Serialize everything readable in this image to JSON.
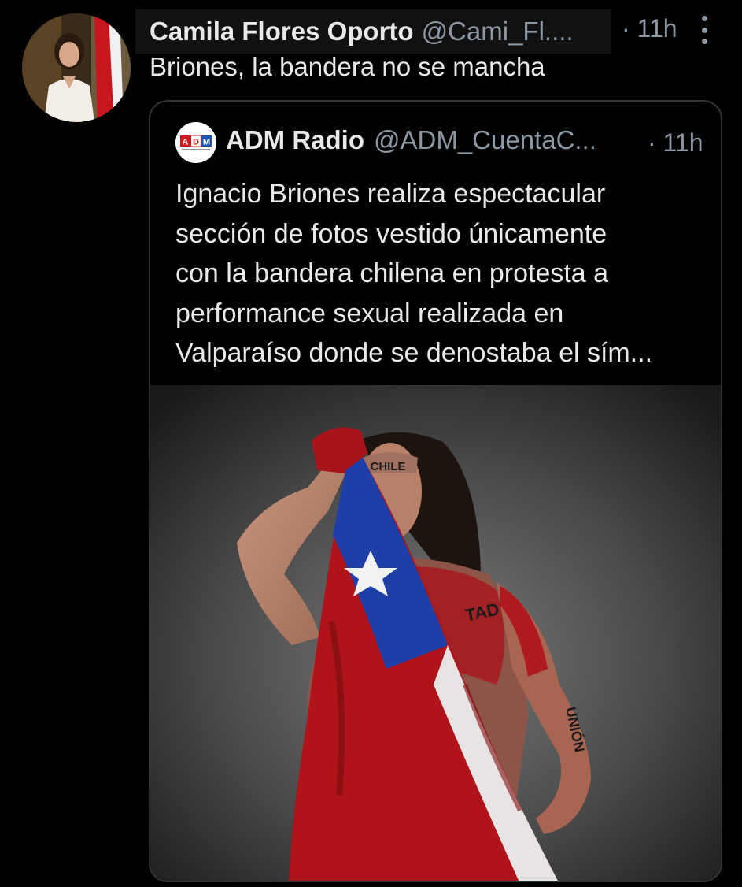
{
  "tweet": {
    "author": {
      "display_name": "Camila Flores Oporto",
      "handle": "@Cami_Fl....",
      "avatar_icon": "profile-photo"
    },
    "timestamp": "11h",
    "timestamp_separator": "·",
    "text": "Briones, la bandera no se mancha",
    "more_icon": "vertical-ellipsis-icon"
  },
  "quoted_tweet": {
    "author": {
      "display_name": "ADM Radio",
      "handle": "@ADM_CuentaC...",
      "avatar_logo_text": "ADM"
    },
    "timestamp": "11h",
    "timestamp_separator": "·",
    "text_lines": [
      "Ignacio Briones realiza espectacular",
      "sección de fotos vestido únicamente",
      "con la bandera chilena en protesta a",
      "performance sexual realizada en",
      "Valparaíso donde se denostaba el sím..."
    ],
    "media": {
      "body_writing": [
        "CHILE",
        "TAD",
        "UNIÓN"
      ]
    }
  },
  "colors": {
    "background": "#000000",
    "text_primary": "#e7e9ea",
    "text_secondary": "#8b98a5",
    "border": "#2f3336",
    "flag_red": "#b0141a",
    "flag_blue": "#1f3fa8"
  }
}
